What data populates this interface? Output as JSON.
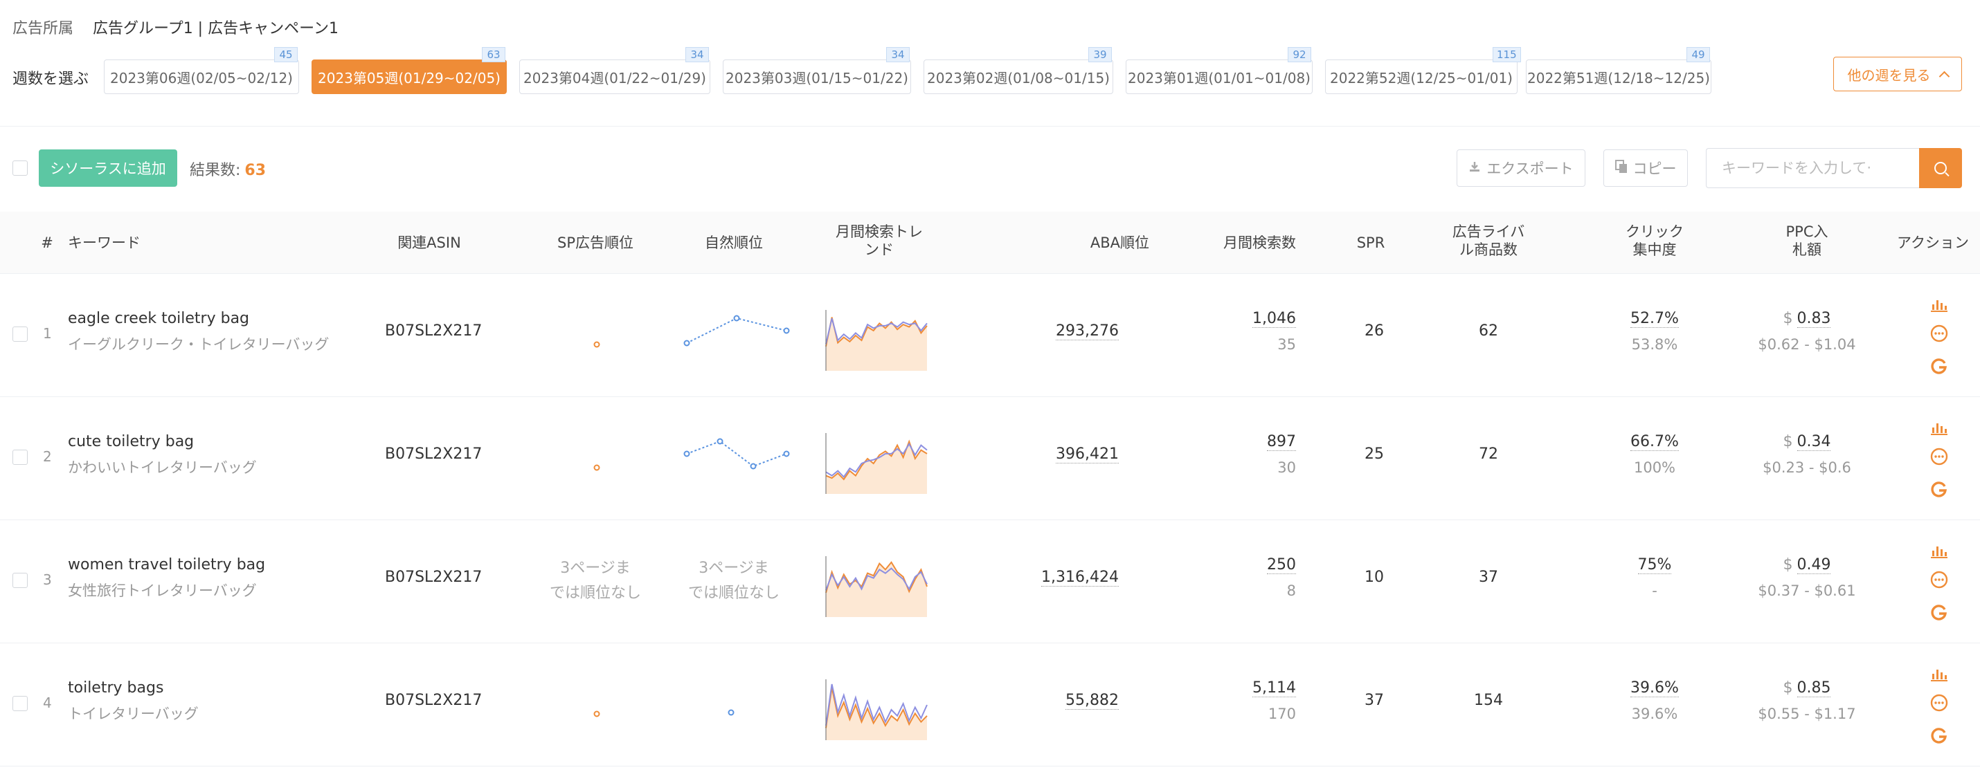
{
  "ad_affiliation": {
    "label": "広告所属",
    "value": "広告グループ1 | 広告キャンペーン1"
  },
  "week_select": {
    "label": "週数を選ぶ",
    "weeks": [
      {
        "label": "2023第06週(02/05~02/12)",
        "count": "45",
        "active": false
      },
      {
        "label": "2023第05週(01/29~02/05)",
        "count": "63",
        "active": true
      },
      {
        "label": "2023第04週(01/22~01/29)",
        "count": "34",
        "active": false
      },
      {
        "label": "2023第03週(01/15~01/22)",
        "count": "34",
        "active": false
      },
      {
        "label": "2023第02週(01/08~01/15)",
        "count": "39",
        "active": false
      },
      {
        "label": "2023第01週(01/01~01/08)",
        "count": "92",
        "active": false
      },
      {
        "label": "2022第52週(12/25~01/01)",
        "count": "115",
        "active": false
      },
      {
        "label": "2022第51週(12/18~12/25)",
        "count": "49",
        "active": false
      }
    ],
    "other_weeks_label": "他の週を見る"
  },
  "toolbar": {
    "add_label": "シソーラスに追加",
    "results_label": "結果数:",
    "results_count": "63",
    "export_label": "エクスポート",
    "copy_label": "コピー",
    "search_placeholder": "キーワードを入力して‧",
    "search_value": ""
  },
  "columns": {
    "num": "#",
    "keyword": "キーワード",
    "asin": "関連ASIN",
    "sp_rank": "SP広告順位",
    "natural_rank": "自然順位",
    "trend_1": "月間検索トレ",
    "trend_2": "ンド",
    "aba": "ABA順位",
    "monthly": "月間検索数",
    "spr": "SPR",
    "rival_1": "広告ライバ",
    "rival_2": "ル商品数",
    "click_1": "クリック",
    "click_2": "集中度",
    "ppc_1": "PPC入",
    "ppc_2": "札額",
    "action": "アクション"
  },
  "rows": [
    {
      "num": "1",
      "keyword": "eagle creek toiletry bag",
      "keyword_jp": "イーグルクリーク・トイレタリーバッグ",
      "asin": "B07SL2X217",
      "sp_rank_text": "",
      "natural_rank_text": "",
      "natural_rank_trend": [
        3,
        1,
        2
      ],
      "search_trend": [
        {
          "series": "orange",
          "values": [
            40,
            88,
            46,
            55,
            48,
            58,
            50,
            72,
            66,
            78,
            70,
            80,
            68,
            76,
            72,
            82,
            62,
            74
          ]
        },
        {
          "series": "blue",
          "values": [
            44,
            86,
            50,
            60,
            52,
            62,
            54,
            76,
            70,
            74,
            74,
            78,
            72,
            80,
            76,
            78,
            66,
            78
          ]
        }
      ],
      "aba": "293,276",
      "monthly": "1,046",
      "monthly_sub": "35",
      "spr": "26",
      "rivals": "62",
      "click": "52.7%",
      "click_sub": "53.8%",
      "ppc_sym": "$",
      "ppc": "0.83",
      "ppc_range": "$0.62 - $1.04"
    },
    {
      "num": "2",
      "keyword": "cute toiletry bag",
      "keyword_jp": "かわいいトイレタリーバッグ",
      "asin": "B07SL2X217",
      "sp_rank_text": "",
      "natural_rank_text": "",
      "natural_rank_trend": [
        2,
        1,
        3,
        2
      ],
      "search_trend": [
        {
          "series": "orange",
          "values": [
            30,
            26,
            34,
            24,
            38,
            30,
            46,
            58,
            50,
            64,
            70,
            62,
            80,
            60,
            86,
            58,
            72,
            66
          ]
        },
        {
          "series": "blue",
          "values": [
            36,
            30,
            38,
            28,
            42,
            36,
            50,
            54,
            56,
            60,
            66,
            66,
            74,
            66,
            82,
            64,
            80,
            72
          ]
        }
      ],
      "aba": "396,421",
      "monthly": "897",
      "monthly_sub": "30",
      "spr": "25",
      "rivals": "72",
      "click": "66.7%",
      "click_sub": "100%",
      "ppc_sym": "$",
      "ppc": "0.34",
      "ppc_range": "$0.23 - $0.6"
    },
    {
      "num": "3",
      "keyword": "women travel toiletry bag",
      "keyword_jp": "女性旅行トイレタリーバッグ",
      "asin": "B07SL2X217",
      "sp_rank_text": "3ページまでは順位なし",
      "natural_rank_text": "3ページまでは順位なし",
      "natural_rank_trend": [],
      "search_trend": [
        {
          "series": "orange",
          "values": [
            40,
            74,
            48,
            70,
            54,
            60,
            50,
            72,
            68,
            88,
            78,
            90,
            74,
            66,
            42,
            62,
            78,
            50
          ]
        },
        {
          "series": "blue",
          "values": [
            44,
            70,
            52,
            66,
            50,
            64,
            46,
            68,
            64,
            78,
            72,
            80,
            70,
            62,
            46,
            66,
            74,
            54
          ]
        }
      ],
      "aba": "1,316,424",
      "monthly": "250",
      "monthly_sub": "8",
      "spr": "10",
      "rivals": "37",
      "click": "75%",
      "click_sub": "-",
      "ppc_sym": "$",
      "ppc": "0.49",
      "ppc_range": "$0.37 - $0.61"
    },
    {
      "num": "4",
      "keyword": "toiletry bags",
      "keyword_jp": "トイレタリーバッグ",
      "asin": "B07SL2X217",
      "sp_rank_text": "",
      "natural_rank_text": "",
      "natural_rank_trend": [
        1
      ],
      "search_trend": [
        {
          "series": "orange",
          "values": [
            20,
            86,
            40,
            62,
            34,
            58,
            30,
            52,
            28,
            44,
            24,
            40,
            32,
            50,
            26,
            44,
            30,
            40
          ]
        },
        {
          "series": "blue",
          "values": [
            24,
            92,
            46,
            74,
            40,
            70,
            36,
            64,
            34,
            54,
            30,
            50,
            40,
            60,
            32,
            54,
            36,
            58
          ]
        }
      ],
      "aba": "55,882",
      "monthly": "5,114",
      "monthly_sub": "170",
      "spr": "37",
      "rivals": "154",
      "click": "39.6%",
      "click_sub": "39.6%",
      "ppc_sym": "$",
      "ppc": "0.85",
      "ppc_range": "$0.55 - $1.17"
    }
  ],
  "colors": {
    "accent": "#ef8c37",
    "green": "#5cc7a3",
    "blue_line": "#5a93e0",
    "orange_line": "#ef8c37",
    "fill": "#fde8d4"
  },
  "icons": {
    "analytics": "bar-chart-icon",
    "more": "more-dots-icon",
    "google": "google-icon",
    "export": "download-icon",
    "copy": "copy-icon",
    "search": "search-icon"
  }
}
